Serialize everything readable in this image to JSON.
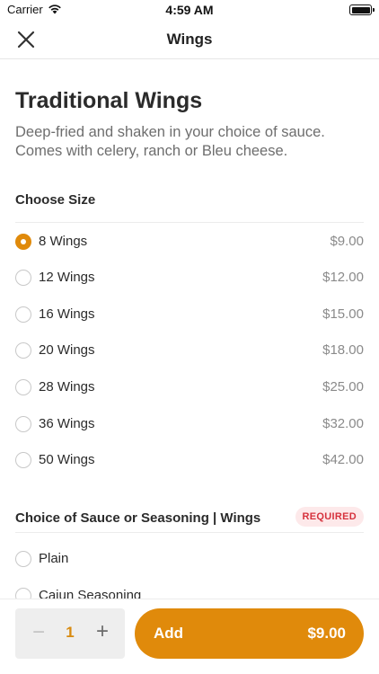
{
  "status_bar": {
    "carrier": "Carrier",
    "time": "4:59 AM"
  },
  "nav": {
    "title": "Wings",
    "close_icon": "close-icon"
  },
  "item": {
    "title": "Traditional Wings",
    "description": "Deep-fried and shaken in your choice of sauce. Comes with celery, ranch or Bleu cheese."
  },
  "size_section": {
    "title": "Choose Size",
    "options": [
      {
        "label": "8 Wings",
        "price": "$9.00",
        "selected": true
      },
      {
        "label": "12 Wings",
        "price": "$12.00",
        "selected": false
      },
      {
        "label": "16 Wings",
        "price": "$15.00",
        "selected": false
      },
      {
        "label": "20 Wings",
        "price": "$18.00",
        "selected": false
      },
      {
        "label": "28 Wings",
        "price": "$25.00",
        "selected": false
      },
      {
        "label": "36 Wings",
        "price": "$32.00",
        "selected": false
      },
      {
        "label": "50 Wings",
        "price": "$42.00",
        "selected": false
      }
    ]
  },
  "sauce_section": {
    "title": "Choice of Sauce or Seasoning | Wings",
    "badge": "REQUIRED",
    "options": [
      {
        "label": "Plain",
        "selected": false
      },
      {
        "label": "Cajun Seasoning",
        "selected": false
      }
    ]
  },
  "bottom_bar": {
    "quantity": "1",
    "minus": "−",
    "plus": "+",
    "add_label": "Add",
    "add_price": "$9.00"
  },
  "colors": {
    "accent": "#e08a0b",
    "required_text": "#d6323d",
    "required_bg": "#fde9ea"
  }
}
